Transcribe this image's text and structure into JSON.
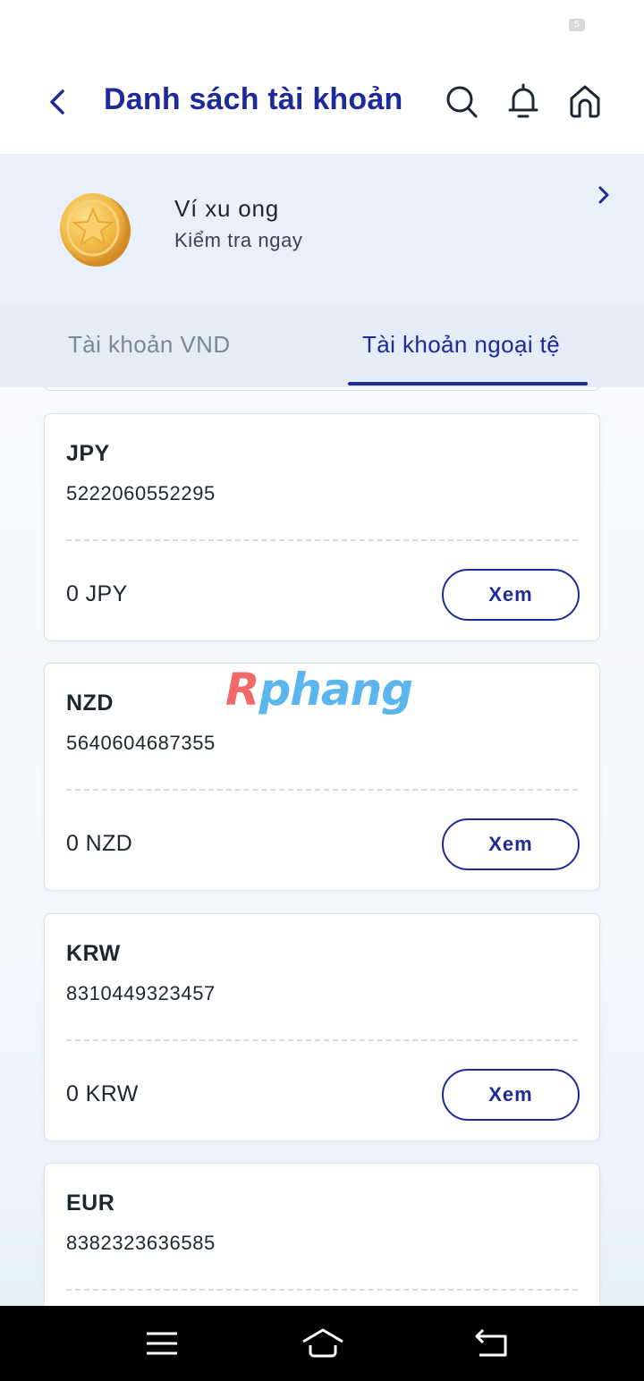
{
  "status_bar": {
    "battery": "5"
  },
  "header": {
    "title": "Danh sách tài khoản",
    "icons": [
      "back-arrow-icon",
      "search-icon",
      "bell-icon",
      "home-icon"
    ]
  },
  "promo": {
    "title": "Ví xu ong",
    "subtitle": "Kiểm tra ngay",
    "icon": "gold-coin-star-icon"
  },
  "tabs": [
    {
      "label": "Tài khoản VND",
      "active": false
    },
    {
      "label": "Tài khoản ngoại tệ",
      "active": true
    }
  ],
  "accounts": [
    {
      "currency": "JPY",
      "number": "5222060552295",
      "balance": "0 JPY",
      "button": "Xem"
    },
    {
      "currency": "NZD",
      "number": "5640604687355",
      "balance": "0 NZD",
      "button": "Xem"
    },
    {
      "currency": "KRW",
      "number": "8310449323457",
      "balance": "0 KRW",
      "button": "Xem"
    },
    {
      "currency": "EUR",
      "number": "8382323636585",
      "balance": "",
      "button": ""
    }
  ],
  "watermark": {
    "first": "R",
    "rest": "phang"
  },
  "colors": {
    "brand": "#1f2a99",
    "promo_bg": "#e8f1fb",
    "tabs_bg": "#e3ecf7",
    "coin": "#f2c14e"
  },
  "nav_bar": {
    "icons": [
      "menu-icon",
      "home-outline-icon",
      "back-return-icon"
    ]
  }
}
